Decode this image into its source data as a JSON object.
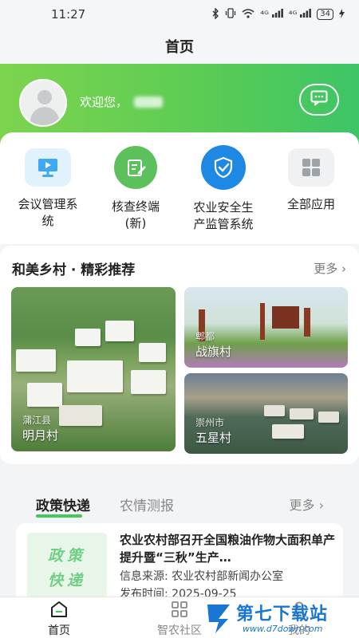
{
  "status_bar": {
    "time": "11:27",
    "icons": [
      "bluetooth-icon",
      "vibrate-icon",
      "wifi-icon",
      "signal-icon",
      "signal-icon"
    ],
    "signal_label_1": "⁴ᴳ",
    "signal_label_2": "⁴ᴳ",
    "battery": "34"
  },
  "title_bar": {
    "title": "首页"
  },
  "header": {
    "welcome": "欢迎您，",
    "message_icon": "chat-icon"
  },
  "apps": [
    {
      "label": "会议管理系\n统",
      "icon": "presentation-icon",
      "color": "#3fa9f5"
    },
    {
      "label": "核查终端\n(新)",
      "icon": "edit-doc-icon",
      "color": "#5cc05c"
    },
    {
      "label": "农业安全生\n产监管系统",
      "icon": "shield-icon",
      "color": "#1e88e5"
    },
    {
      "label": "全部应用",
      "icon": "grid-icon",
      "color": "#9ea3a8"
    }
  ],
  "village_section": {
    "title": "和美乡村 · 精彩推荐",
    "more": "更多 ›",
    "items": [
      {
        "location": "蒲江县",
        "name": "明月村"
      },
      {
        "location": "郫都",
        "name": "战旗村"
      },
      {
        "location": "崇州市",
        "name": "五星村"
      }
    ]
  },
  "news_section": {
    "tabs": [
      "政策快递",
      "农情测报"
    ],
    "more": "更多 ›",
    "thumb_text_1": "政策",
    "thumb_text_2": "快递",
    "title": "农业农村部召开全国粮油作物大面积单产 提升暨“三秋”生产…",
    "source": "信息来源:  农业农村部新闻办公室",
    "date": "发布时间:  2025-09-25"
  },
  "bottom_nav": [
    {
      "label": "首页",
      "icon": "home-icon"
    },
    {
      "label": "智农社区",
      "icon": "community-grid-icon"
    },
    {
      "label": "我的",
      "icon": "user-icon"
    }
  ],
  "watermark": {
    "text": "第七下载站",
    "url": "www.d7down.com"
  },
  "colors": {
    "brand_green": "#47c75c",
    "header_start": "#7dd44e",
    "header_end": "#3dc567"
  }
}
